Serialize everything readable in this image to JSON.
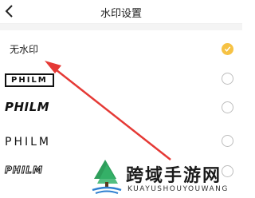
{
  "header": {
    "title": "水印设置",
    "back_icon": "chevron-left-icon"
  },
  "options": [
    {
      "label": "无水印",
      "selected": true
    },
    {
      "label": "PHILM",
      "selected": false
    },
    {
      "label": "PHILM",
      "selected": false
    },
    {
      "label": "PHILM",
      "selected": false
    },
    {
      "label": "PHILM",
      "selected": false
    }
  ],
  "annotation": {
    "type": "arrow",
    "color": "#e53935"
  },
  "watermark": {
    "title": "跨域手游网",
    "subtitle": "KUAYUSHOUYOUWANG"
  },
  "colors": {
    "selected": "#f6c244",
    "radio_border": "#bdbdbd",
    "separator": "#f4f4f4"
  }
}
